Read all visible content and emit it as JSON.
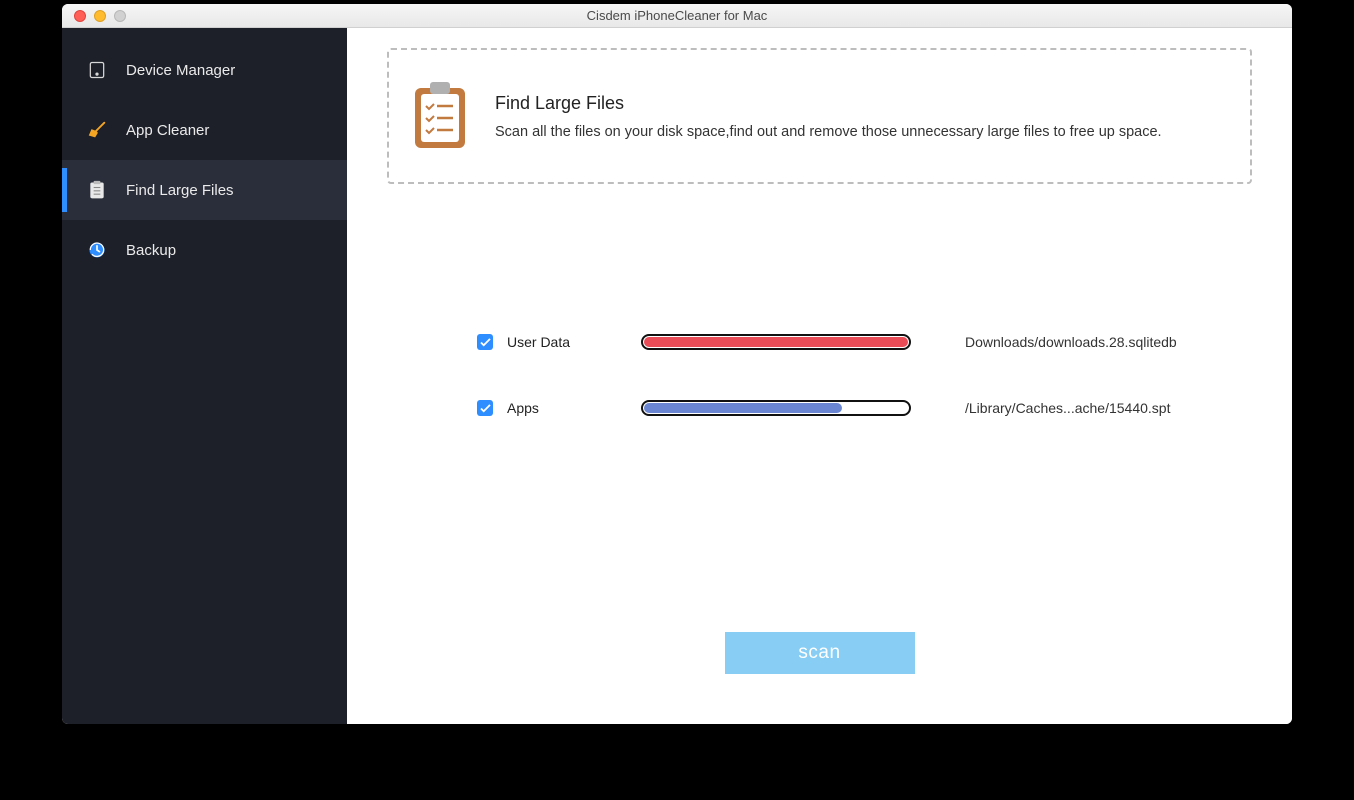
{
  "window": {
    "title": "Cisdem iPhoneCleaner for Mac"
  },
  "sidebar": {
    "items": [
      {
        "label": "Device Manager",
        "icon": "device-manager-icon",
        "active": false
      },
      {
        "label": "App Cleaner",
        "icon": "broom-icon",
        "active": false
      },
      {
        "label": "Find Large Files",
        "icon": "clipboard-icon",
        "active": true
      },
      {
        "label": "Backup",
        "icon": "backup-icon",
        "active": false
      }
    ]
  },
  "card": {
    "title": "Find Large Files",
    "desc": "Scan all the files on your disk space,find out and remove those unnecessary large files to free up space."
  },
  "rows": [
    {
      "checked": true,
      "label": "User Data",
      "progress_pct": 100,
      "bar_color": "red",
      "path": "Downloads/downloads.28.sqlitedb"
    },
    {
      "checked": true,
      "label": "Apps",
      "progress_pct": 75,
      "bar_color": "blue",
      "path": "/Library/Caches...ache/15440.spt"
    }
  ],
  "actions": {
    "scan_label": "scan"
  }
}
